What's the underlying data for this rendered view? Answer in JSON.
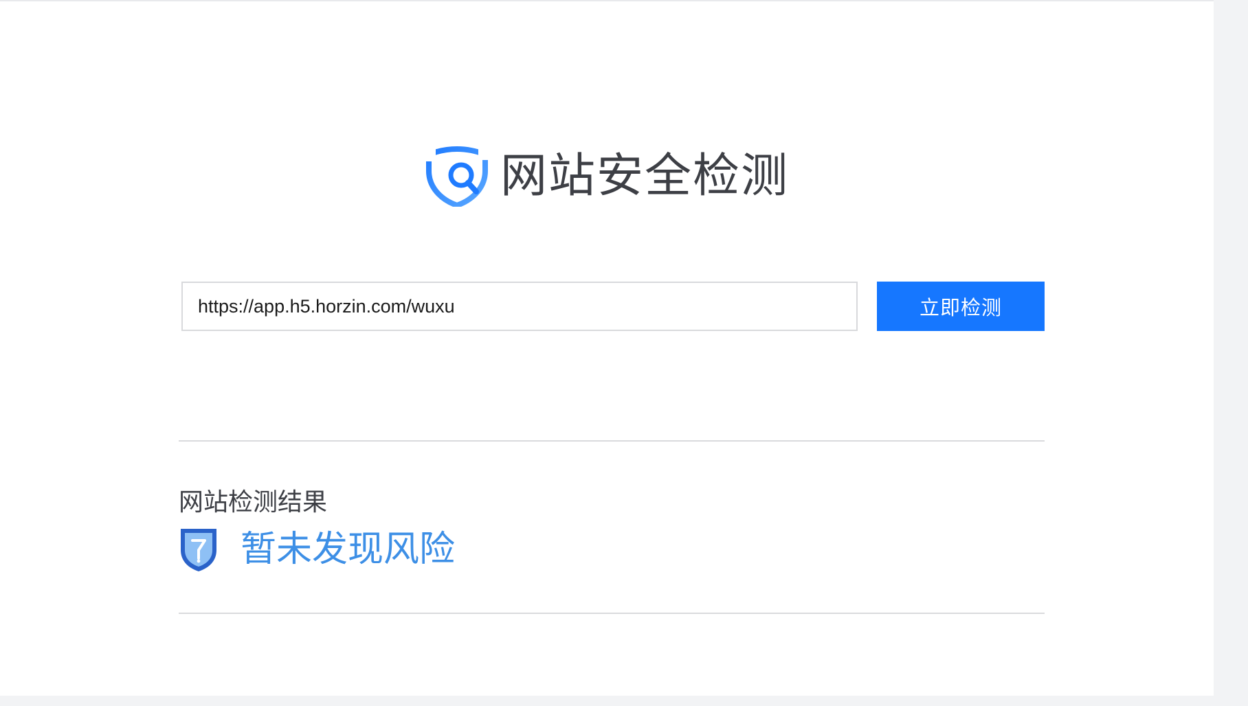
{
  "header": {
    "logo_icon": "shield-search-icon",
    "title": "网站安全检测"
  },
  "search": {
    "url_value": "https://app.h5.horzin.com/wuxu",
    "check_button_label": "立即检测"
  },
  "result": {
    "heading": "网站检测结果",
    "status_icon": "shield-safe-icon",
    "status_text": "暂未发现风险"
  },
  "colors": {
    "accent": "#1677ff",
    "status_text": "#3d8fe6",
    "shield_dark": "#2a62c9",
    "shield_light": "#8ec0f5",
    "title_text": "#3d3f45"
  }
}
